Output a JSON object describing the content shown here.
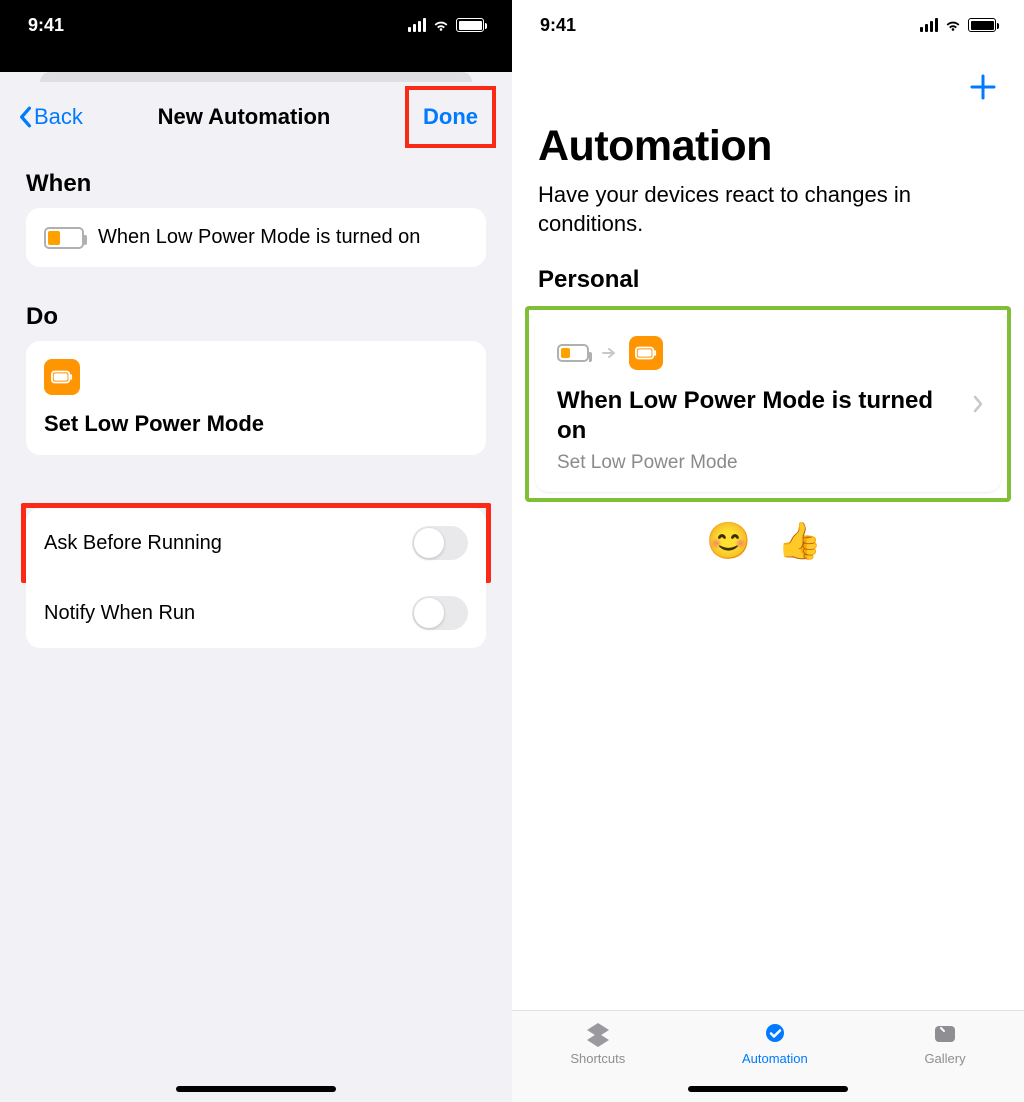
{
  "left": {
    "status_time": "9:41",
    "nav": {
      "back": "Back",
      "title": "New Automation",
      "done": "Done"
    },
    "when_header": "When",
    "when_row": "When Low Power Mode is turned on",
    "do_header": "Do",
    "do_label": "Set Low Power Mode",
    "opt_ask": "Ask Before Running",
    "opt_notify": "Notify When Run"
  },
  "right": {
    "status_time": "9:41",
    "title": "Automation",
    "subtitle": "Have your devices react to changes in conditions.",
    "personal": "Personal",
    "card_title": "When Low Power Mode is turned on",
    "card_sub": "Set Low Power Mode",
    "emojis": "😊 👍",
    "tabs": {
      "shortcuts": "Shortcuts",
      "automation": "Automation",
      "gallery": "Gallery"
    }
  }
}
